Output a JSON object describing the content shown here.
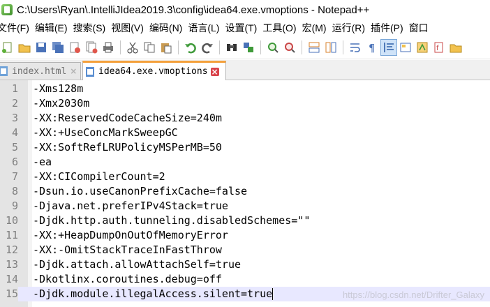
{
  "window": {
    "title": "C:\\Users\\Ryan\\.IntelliJIdea2019.3\\config\\idea64.exe.vmoptions - Notepad++"
  },
  "menu": [
    "文件(F)",
    "编辑(E)",
    "搜索(S)",
    "视图(V)",
    "编码(N)",
    "语言(L)",
    "设置(T)",
    "工具(O)",
    "宏(M)",
    "运行(R)",
    "插件(P)",
    "窗口"
  ],
  "tabs": [
    {
      "label": "index.html",
      "close": "×"
    },
    {
      "label": "idea64.exe.vmoptions",
      "close": "×"
    }
  ],
  "editor": {
    "lines": [
      {
        "num": "1",
        "text": "-Xms128m"
      },
      {
        "num": "2",
        "text": "-Xmx2030m"
      },
      {
        "num": "3",
        "text": "-XX:ReservedCodeCacheSize=240m"
      },
      {
        "num": "4",
        "text": "-XX:+UseConcMarkSweepGC"
      },
      {
        "num": "5",
        "text": "-XX:SoftRefLRUPolicyMSPerMB=50"
      },
      {
        "num": "6",
        "text": "-ea"
      },
      {
        "num": "7",
        "text": "-XX:CICompilerCount=2"
      },
      {
        "num": "8",
        "text": "-Dsun.io.useCanonPrefixCache=false"
      },
      {
        "num": "9",
        "text": "-Djava.net.preferIPv4Stack=true"
      },
      {
        "num": "10",
        "text": "-Djdk.http.auth.tunneling.disabledSchemes=\"\""
      },
      {
        "num": "11",
        "text": "-XX:+HeapDumpOnOutOfMemoryError"
      },
      {
        "num": "12",
        "text": "-XX:-OmitStackTraceInFastThrow"
      },
      {
        "num": "13",
        "text": "-Djdk.attach.allowAttachSelf=true"
      },
      {
        "num": "14",
        "text": "-Dkotlinx.coroutines.debug=off"
      },
      {
        "num": "15",
        "text": "-Djdk.module.illegalAccess.silent=true"
      }
    ]
  },
  "watermark": "https://blog.csdn.net/Drifter_Galaxy",
  "colors": {
    "current_line": "#e8e8ff",
    "active_tab_accent": "#f4a13c",
    "gutter": "#e4e4e4"
  }
}
